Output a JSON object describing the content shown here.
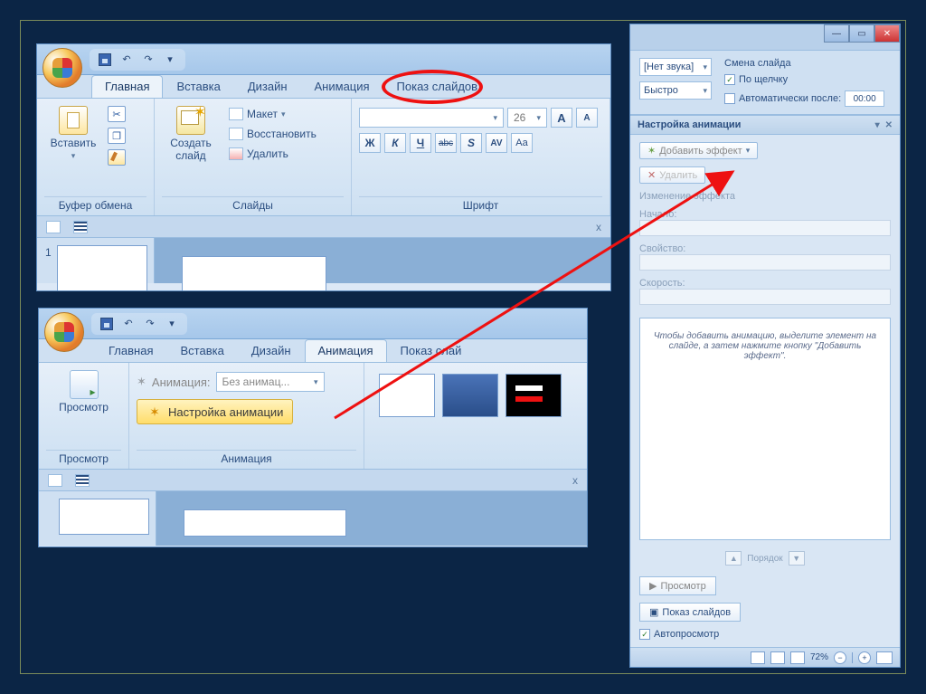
{
  "tabs": {
    "home": "Главная",
    "insert": "Вставка",
    "design": "Дизайн",
    "animation": "Анимация",
    "slideshow": "Показ слайдов",
    "slideshow_short": "Показ слай"
  },
  "clipboard": {
    "paste": "Вставить",
    "group": "Буфер обмена"
  },
  "slides_group": {
    "new": "Создать\nслайд",
    "layout": "Макет",
    "reset": "Восстановить",
    "delete": "Удалить",
    "group": "Слайды"
  },
  "font_group": {
    "size": "26",
    "group": "Шрифт",
    "bold": "Ж",
    "italic": "К",
    "underline": "Ч",
    "strike": "abc",
    "shadow": "S",
    "spacing": "AV",
    "case": "Aa"
  },
  "slide_number": "1",
  "pane": {
    "outline": "",
    "close": "x"
  },
  "panel2": {
    "preview": "Просмотр",
    "preview_group": "Просмотр",
    "anim_label": "Анимация:",
    "anim_value": "Без анимац...",
    "custom_anim": "Настройка анимации",
    "anim_group": "Анимация"
  },
  "panel3": {
    "sound": "[Нет звука]",
    "speed": "Быстро",
    "advance_title": "Смена слайда",
    "on_click": "По щелчку",
    "auto_after": "Автоматически после:",
    "auto_time": "00:00",
    "taskpane_title": "Настройка анимации",
    "add_effect": "Добавить эффект",
    "remove": "Удалить",
    "change_effect": "Изменение эффекта",
    "start": "Начало:",
    "property": "Свойство:",
    "speed_lbl": "Скорость:",
    "hint": "Чтобы добавить анимацию, выделите элемент на слайде, а затем нажмите кнопку \"Добавить эффект\".",
    "reorder": "Порядок",
    "play": "Просмотр",
    "slideshow_btn": "Показ слайдов",
    "autopreview": "Автопросмотр",
    "zoom": "72%"
  }
}
